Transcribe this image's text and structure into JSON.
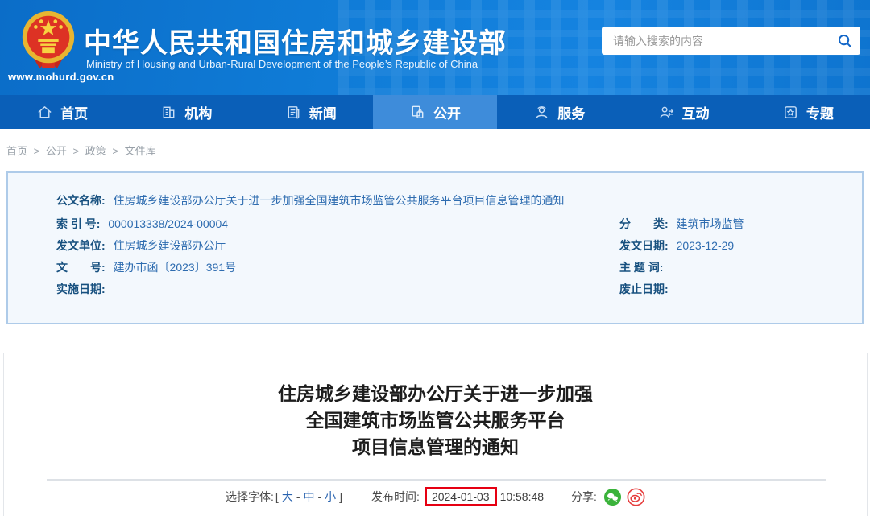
{
  "header": {
    "site_url": "www.mohurd.gov.cn",
    "title": "中华人民共和国住房和城乡建设部",
    "subtitle": "Ministry of Housing and Urban-Rural Development of the People’s Republic of China",
    "search": {
      "placeholder": "请输入搜索的内容",
      "icon": "search-icon"
    }
  },
  "nav": {
    "items": [
      {
        "label": "首页",
        "icon": "home-icon",
        "active": false
      },
      {
        "label": "机构",
        "icon": "organization-icon",
        "active": false
      },
      {
        "label": "新闻",
        "icon": "news-icon",
        "active": false
      },
      {
        "label": "公开",
        "icon": "disclosure-icon",
        "active": true
      },
      {
        "label": "服务",
        "icon": "service-icon",
        "active": false
      },
      {
        "label": "互动",
        "icon": "interaction-icon",
        "active": false
      },
      {
        "label": "专题",
        "icon": "topics-icon",
        "active": false
      }
    ]
  },
  "breadcrumb": {
    "separator": ">",
    "items": [
      "首页",
      "公开",
      "政策",
      "文件库"
    ]
  },
  "doc_meta": {
    "title": {
      "label": "公文名称:",
      "value": "住房城乡建设部办公厅关于进一步加强全国建筑市场监管公共服务平台项目信息管理的通知"
    },
    "left": [
      {
        "label": "索 引 号:",
        "value": "000013338/2024-00004"
      },
      {
        "label": "发文单位:",
        "value": "住房城乡建设部办公厅"
      },
      {
        "label": "文　　号:",
        "value": "建办市函〔2023〕391号"
      },
      {
        "label": "实施日期:",
        "value": ""
      }
    ],
    "right": [
      {
        "label": "分　　类:",
        "value": "建筑市场监管"
      },
      {
        "label": "发文日期:",
        "value": "2023-12-29"
      },
      {
        "label": "主 题 词:",
        "value": ""
      },
      {
        "label": "废止日期:",
        "value": ""
      }
    ]
  },
  "article": {
    "title_line1": "住房城乡建设部办公厅关于进一步加强",
    "title_line2": "全国建筑市场监管公共服务平台",
    "title_line3": "项目信息管理的通知",
    "font_selector": {
      "label": "选择字体:",
      "bracket_open": "[",
      "bracket_close": "]",
      "dash": "-",
      "options": [
        "大",
        "中",
        "小"
      ]
    },
    "publish": {
      "label": "发布时间:",
      "date": "2024-01-03",
      "time": "10:58:48"
    },
    "share": {
      "label": "分享:",
      "icons": [
        "wechat-icon",
        "weibo-icon"
      ]
    }
  },
  "colors": {
    "header_blue": "#0f7bd6",
    "nav_blue": "#0a5fb8",
    "nav_active_blue": "#3e8cda",
    "meta_bg": "#f3f8fd",
    "meta_border": "#aecbe9",
    "meta_label_blue": "#17507f",
    "meta_value_blue": "#2e6cb0",
    "link_blue": "#2a64b0",
    "annotation_red": "#e60012",
    "wechat_green": "#3bb33b",
    "weibo_red": "#e63c3c"
  }
}
